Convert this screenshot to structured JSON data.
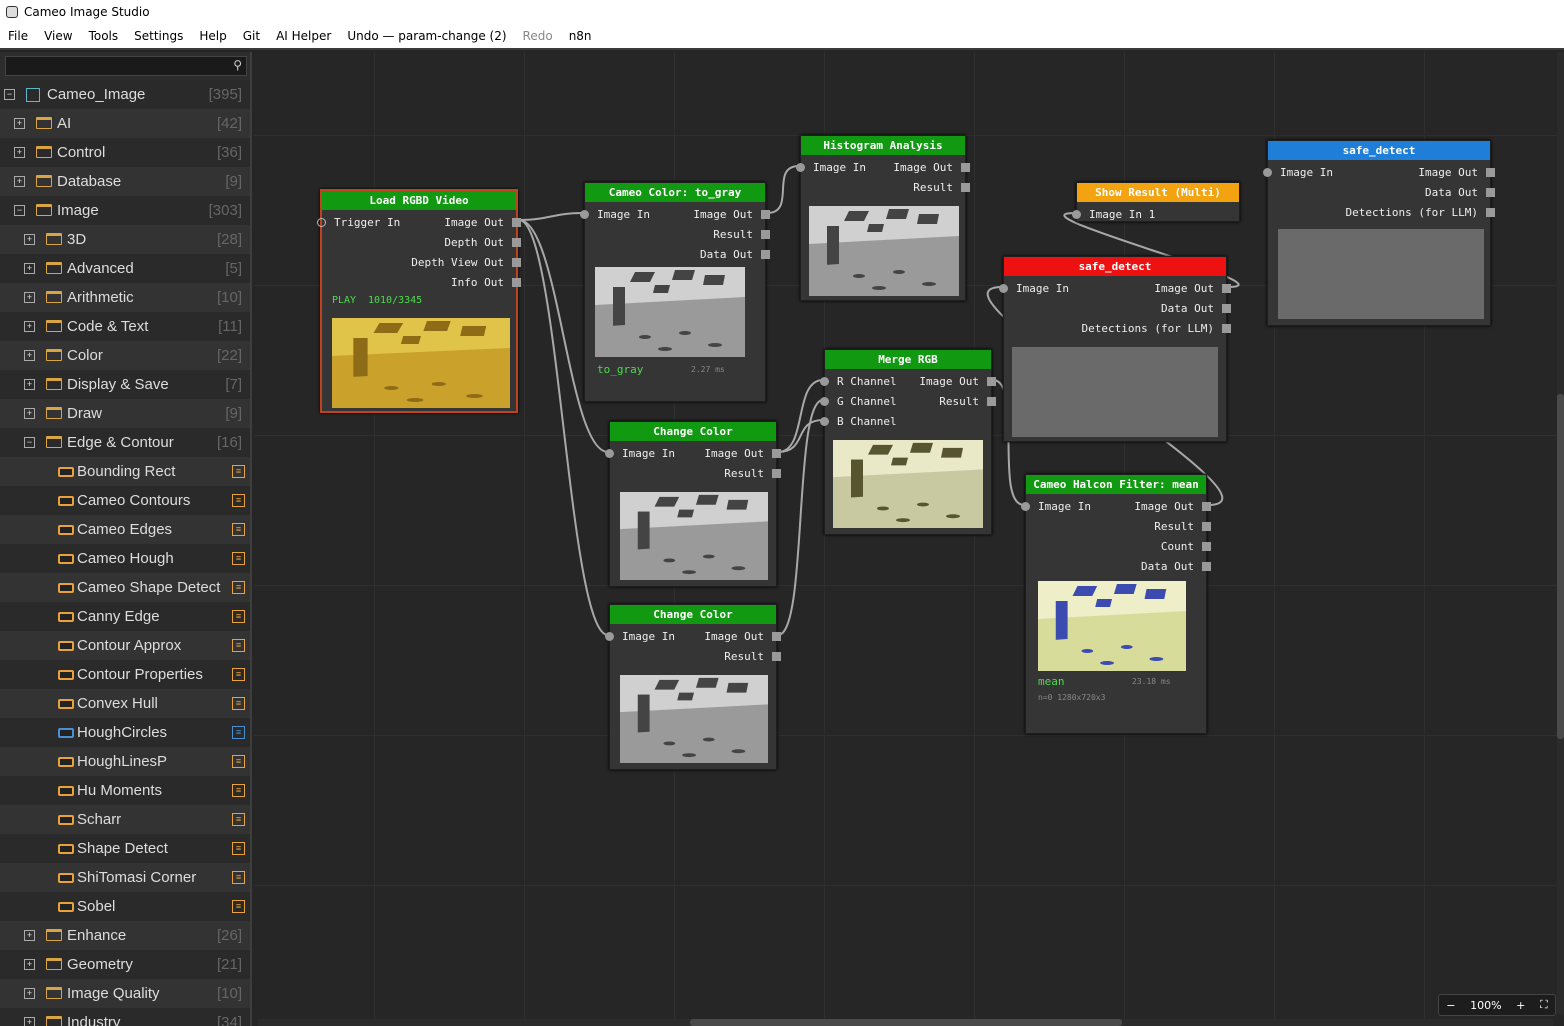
{
  "window": {
    "title": "Cameo Image Studio"
  },
  "menu": [
    "File",
    "View",
    "Tools",
    "Settings",
    "Help",
    "Git",
    "AI Helper",
    "Undo — param-change (2)",
    "Redo",
    "n8n"
  ],
  "search": {
    "placeholder": ""
  },
  "tree": [
    {
      "label": "Cameo_Image",
      "count": "[395]",
      "level": 0,
      "kind": "root"
    },
    {
      "label": "AI",
      "count": "[42]",
      "level": 1,
      "kind": "folder"
    },
    {
      "label": "Control",
      "count": "[36]",
      "level": 1,
      "kind": "folder"
    },
    {
      "label": "Database",
      "count": "[9]",
      "level": 1,
      "kind": "folder"
    },
    {
      "label": "Image",
      "count": "[303]",
      "level": 1,
      "kind": "folder",
      "expanded": true
    },
    {
      "label": "3D",
      "count": "[28]",
      "level": 2,
      "kind": "folder"
    },
    {
      "label": "Advanced",
      "count": "[5]",
      "level": 2,
      "kind": "folder"
    },
    {
      "label": "Arithmetic",
      "count": "[10]",
      "level": 2,
      "kind": "folder"
    },
    {
      "label": "Code & Text",
      "count": "[11]",
      "level": 2,
      "kind": "folder"
    },
    {
      "label": "Color",
      "count": "[22]",
      "level": 2,
      "kind": "folder"
    },
    {
      "label": "Display & Save",
      "count": "[7]",
      "level": 2,
      "kind": "folder"
    },
    {
      "label": "Draw",
      "count": "[9]",
      "level": 2,
      "kind": "folder"
    },
    {
      "label": "Edge & Contour",
      "count": "[16]",
      "level": 2,
      "kind": "folder",
      "expanded": true
    },
    {
      "label": "Bounding Rect",
      "level": 3,
      "kind": "node"
    },
    {
      "label": "Cameo Contours",
      "level": 3,
      "kind": "node"
    },
    {
      "label": "Cameo Edges",
      "level": 3,
      "kind": "node"
    },
    {
      "label": "Cameo Hough",
      "level": 3,
      "kind": "node"
    },
    {
      "label": "Cameo Shape Detect",
      "level": 3,
      "kind": "node"
    },
    {
      "label": "Canny Edge",
      "level": 3,
      "kind": "node"
    },
    {
      "label": "Contour Approx",
      "level": 3,
      "kind": "node"
    },
    {
      "label": "Contour Properties",
      "level": 3,
      "kind": "node"
    },
    {
      "label": "Convex Hull",
      "level": 3,
      "kind": "node"
    },
    {
      "label": "HoughCircles",
      "level": 3,
      "kind": "node",
      "variant": "blue"
    },
    {
      "label": "HoughLinesP",
      "level": 3,
      "kind": "node"
    },
    {
      "label": "Hu Moments",
      "level": 3,
      "kind": "node"
    },
    {
      "label": "Scharr",
      "level": 3,
      "kind": "node"
    },
    {
      "label": "Shape Detect",
      "level": 3,
      "kind": "node"
    },
    {
      "label": "ShiTomasi Corner",
      "level": 3,
      "kind": "node"
    },
    {
      "label": "Sobel",
      "level": 3,
      "kind": "node"
    },
    {
      "label": "Enhance",
      "count": "[26]",
      "level": 2,
      "kind": "folder"
    },
    {
      "label": "Geometry",
      "count": "[21]",
      "level": 2,
      "kind": "folder"
    },
    {
      "label": "Image Quality",
      "count": "[10]",
      "level": 2,
      "kind": "folder"
    },
    {
      "label": "Industry",
      "count": "[34]",
      "level": 2,
      "kind": "folder"
    }
  ],
  "nodes": {
    "load": {
      "title": "Load RGBD Video",
      "inputs": [
        "Trigger In"
      ],
      "outputs": [
        "Image Out",
        "Depth Out",
        "Depth View Out",
        "Info Out"
      ],
      "status": "PLAY",
      "frame": "1010/3345"
    },
    "gray": {
      "title": "Cameo Color: to_gray",
      "inputs": [
        "Image In"
      ],
      "outputs": [
        "Image Out",
        "Result",
        "Data Out"
      ],
      "caption": "to_gray",
      "time": "2.27 ms"
    },
    "hist": {
      "title": "Histogram Analysis",
      "inputs": [
        "Image In"
      ],
      "outputs": [
        "Image Out",
        "Result"
      ]
    },
    "show": {
      "title": "Show Result (Multi)",
      "inputs": [
        "Image In 1"
      ],
      "outputs": []
    },
    "safe1": {
      "title": "safe_detect",
      "inputs": [
        "Image In"
      ],
      "outputs": [
        "Image Out",
        "Data Out",
        "Detections (for LLM)"
      ]
    },
    "safe2": {
      "title": "safe_detect",
      "inputs": [
        "Image In"
      ],
      "outputs": [
        "Image Out",
        "Data Out",
        "Detections (for LLM)"
      ]
    },
    "cc1": {
      "title": "Change Color",
      "inputs": [
        "Image In"
      ],
      "outputs": [
        "Image Out",
        "Result"
      ]
    },
    "cc2": {
      "title": "Change Color",
      "inputs": [
        "Image In"
      ],
      "outputs": [
        "Image Out",
        "Result"
      ]
    },
    "merge": {
      "title": "Merge RGB",
      "inputs": [
        "R Channel",
        "G Channel",
        "B Channel"
      ],
      "outputs": [
        "Image Out",
        "Result"
      ]
    },
    "halcon": {
      "title": "Cameo Halcon Filter: mean",
      "inputs": [
        "Image In"
      ],
      "outputs": [
        "Image Out",
        "Result",
        "Count",
        "Data Out"
      ],
      "caption": "mean",
      "time": "23.18 ms",
      "meta": "n=0  1280x720x3"
    }
  },
  "zoom": {
    "level": "100%",
    "minus": "−",
    "plus": "+",
    "fit": "⛶"
  },
  "colors": {
    "green_header": "#129912",
    "red_header": "#ee1111",
    "blue_header": "#1f7ed8",
    "orange_header": "#f2a30f",
    "selected_border": "#c0431f",
    "accent_orange": "#e8a23b"
  }
}
